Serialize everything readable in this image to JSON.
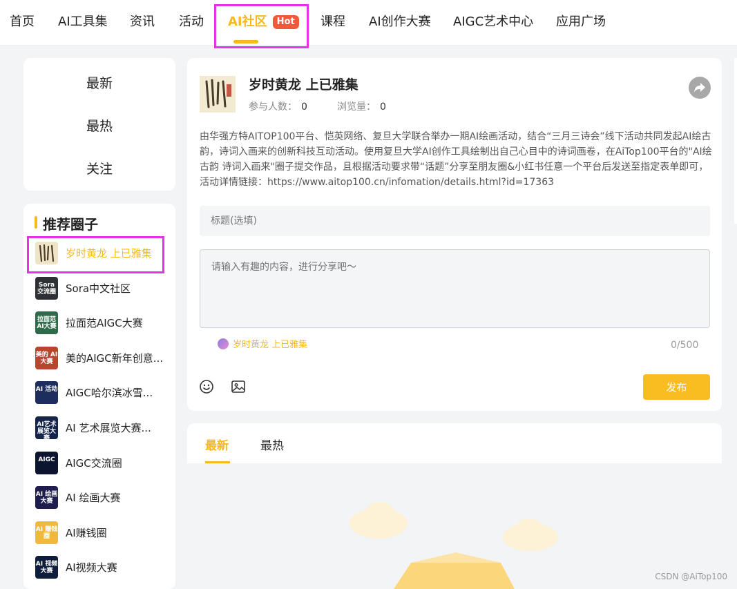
{
  "nav": {
    "items": [
      "首页",
      "AI工具集",
      "资讯",
      "活动",
      "AI社区",
      "课程",
      "AI创作大赛",
      "AIGC艺术中心",
      "应用广场"
    ],
    "hot_badge": "Hot",
    "active_index": 4
  },
  "sort": {
    "items": [
      "最新",
      "最热",
      "关注"
    ]
  },
  "recommend": {
    "title": "推荐圈子",
    "circles": [
      {
        "label": "岁时黄龙 上已雅集",
        "thumb": "",
        "thumb_color": "#efe4c6",
        "selected": true
      },
      {
        "label": "Sora中文社区",
        "thumb": "Sora 交流圈",
        "thumb_color": "#2d3034"
      },
      {
        "label": "拉面范AIGC大赛",
        "thumb": "拉面范 AI大赛",
        "thumb_color": "#2f6b4a"
      },
      {
        "label": "美的AIGC新年创意...",
        "thumb": "美的 AI大赛",
        "thumb_color": "#b9452e"
      },
      {
        "label": "AIGC哈尔滨冰雪...",
        "thumb": "AI 活动",
        "thumb_color": "#1d2d5e"
      },
      {
        "label": "AI 艺术展览大赛...",
        "thumb": "AI艺术 展览大赛",
        "thumb_color": "#14244a"
      },
      {
        "label": "AIGC交流圈",
        "thumb": "AIGC",
        "thumb_color": "#0b1530"
      },
      {
        "label": "AI 绘画大赛",
        "thumb": "AI 绘画大赛",
        "thumb_color": "#1f1c4e"
      },
      {
        "label": "AI赚钱圈",
        "thumb": "AI 赚钱圈",
        "thumb_color": "#f2b73d"
      },
      {
        "label": "AI视频大赛",
        "thumb": "AI 视频大赛",
        "thumb_color": "#0f1d3d"
      }
    ]
  },
  "post": {
    "title": "岁时黄龙 上已雅集",
    "participants_label": "参与人数：",
    "participants": "0",
    "views_label": "浏览量：",
    "views": "0",
    "description": "由华强方特AITOP100平台、恺英网络、复旦大学联合举办一期AI绘画活动，结合“三月三诗会”线下活动共同发起AI绘古韵，诗词入画来的创新科技互动活动。使用复旦大学AI创作工具绘制出自己心目中的诗词画卷，在AiTop100平台的\"AI绘古韵 诗词入画来\"圈子提交作品，且根据活动要求带“话题”分享至朋友圈&小红书任意一个平台后发送至指定表单即可，活动详情链接：https://www.aitop100.cn/infomation/details.html?id=17363",
    "title_placeholder": "标题(选填)",
    "content_placeholder": "请输入有趣的内容，进行分享吧～",
    "tag": "岁时黄龙 上已雅集",
    "counter": "0/500",
    "publish": "发布"
  },
  "feed_tabs": [
    "最新",
    "最热"
  ],
  "watermark": "CSDN @AiTop100",
  "colors": {
    "accent": "#f6b91e",
    "hot": "#f05a3a",
    "publish": "#f9bd22",
    "highlight": "#e631e6"
  }
}
